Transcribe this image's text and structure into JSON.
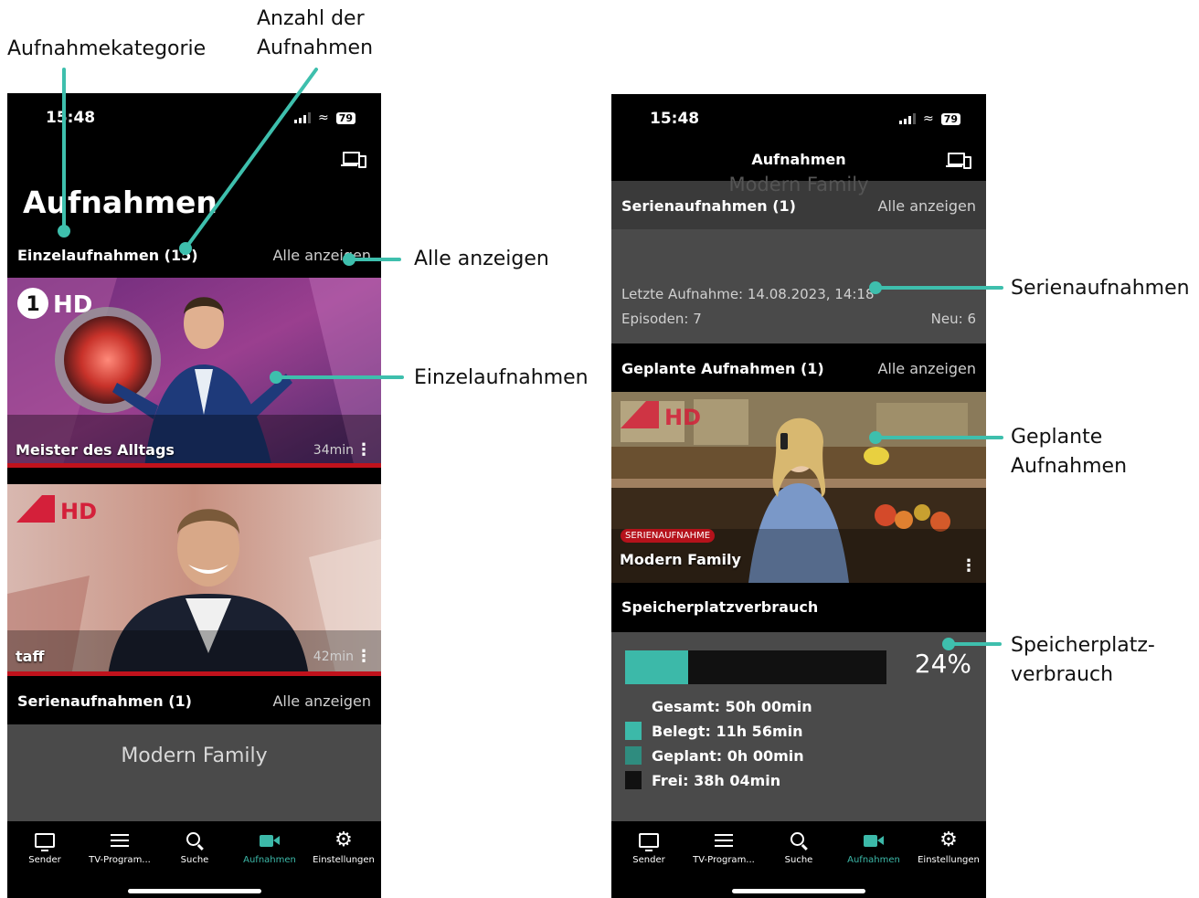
{
  "annotations": {
    "category": "Aufnahmekategorie",
    "count_line1": "Anzahl der",
    "count_line2": "Aufnahmen",
    "show_all": "Alle anzeigen",
    "single": "Einzelaufnahmen",
    "series": "Serienaufnahmen",
    "planned_line1": "Geplante",
    "planned_line2": "Aufnahmen",
    "storage_line1": "Speicherplatz-",
    "storage_line2": "verbrauch"
  },
  "status": {
    "time": "15:48",
    "battery": "79"
  },
  "left_screen": {
    "title": "Aufnahmen",
    "single_section": {
      "title": "Einzelaufnahmen (15)",
      "show_all": "Alle anzeigen"
    },
    "cards": [
      {
        "channel_logo": "1 HD",
        "title": "Meister des Alltags",
        "duration": "34min",
        "progress": 1.0
      },
      {
        "channel_logo": "HD",
        "title": "taff",
        "duration": "42min",
        "progress": 1.0
      }
    ],
    "series_section": {
      "title": "Serienaufnahmen (1)",
      "show_all": "Alle anzeigen"
    },
    "series_name": "Modern Family"
  },
  "right_screen": {
    "header_title": "Aufnahmen",
    "faded_title": "Modern Family",
    "series_section": {
      "title": "Serienaufnahmen (1)",
      "show_all": "Alle anzeigen"
    },
    "series_info": {
      "last": "Letzte Aufnahme: 14.08.2023, 14:18",
      "episodes": "Episoden: 7",
      "new": "Neu: 6"
    },
    "planned_section": {
      "title": "Geplante Aufnahmen (1)",
      "show_all": "Alle anzeigen"
    },
    "planned_card": {
      "channel_logo": "HD",
      "badge": "SERIENAUFNAHME",
      "title": "Modern Family"
    },
    "storage": {
      "title": "Speicherplatzverbrauch",
      "percent_label": "24%",
      "used_fraction": 0.24,
      "total": "Gesamt: 50h 00min",
      "used": "Belegt: 11h 56min",
      "planned": "Geplant: 0h 00min",
      "free": "Frei: 38h 04min"
    }
  },
  "nav": [
    {
      "label": "Sender",
      "icon": "tv-icon",
      "active": false
    },
    {
      "label": "TV-Program...",
      "icon": "list-icon",
      "active": false
    },
    {
      "label": "Suche",
      "icon": "search-icon",
      "active": false
    },
    {
      "label": "Aufnahmen",
      "icon": "camera-icon",
      "active": true
    },
    {
      "label": "Einstellungen",
      "icon": "gear-icon",
      "active": false
    }
  ],
  "colors": {
    "accent": "#3cb9a9",
    "progress": "#c0121c",
    "panel": "#4a4a4a",
    "storage_used": "#3cb9a9",
    "storage_planned": "#2f8c7f",
    "storage_free": "#111111"
  }
}
